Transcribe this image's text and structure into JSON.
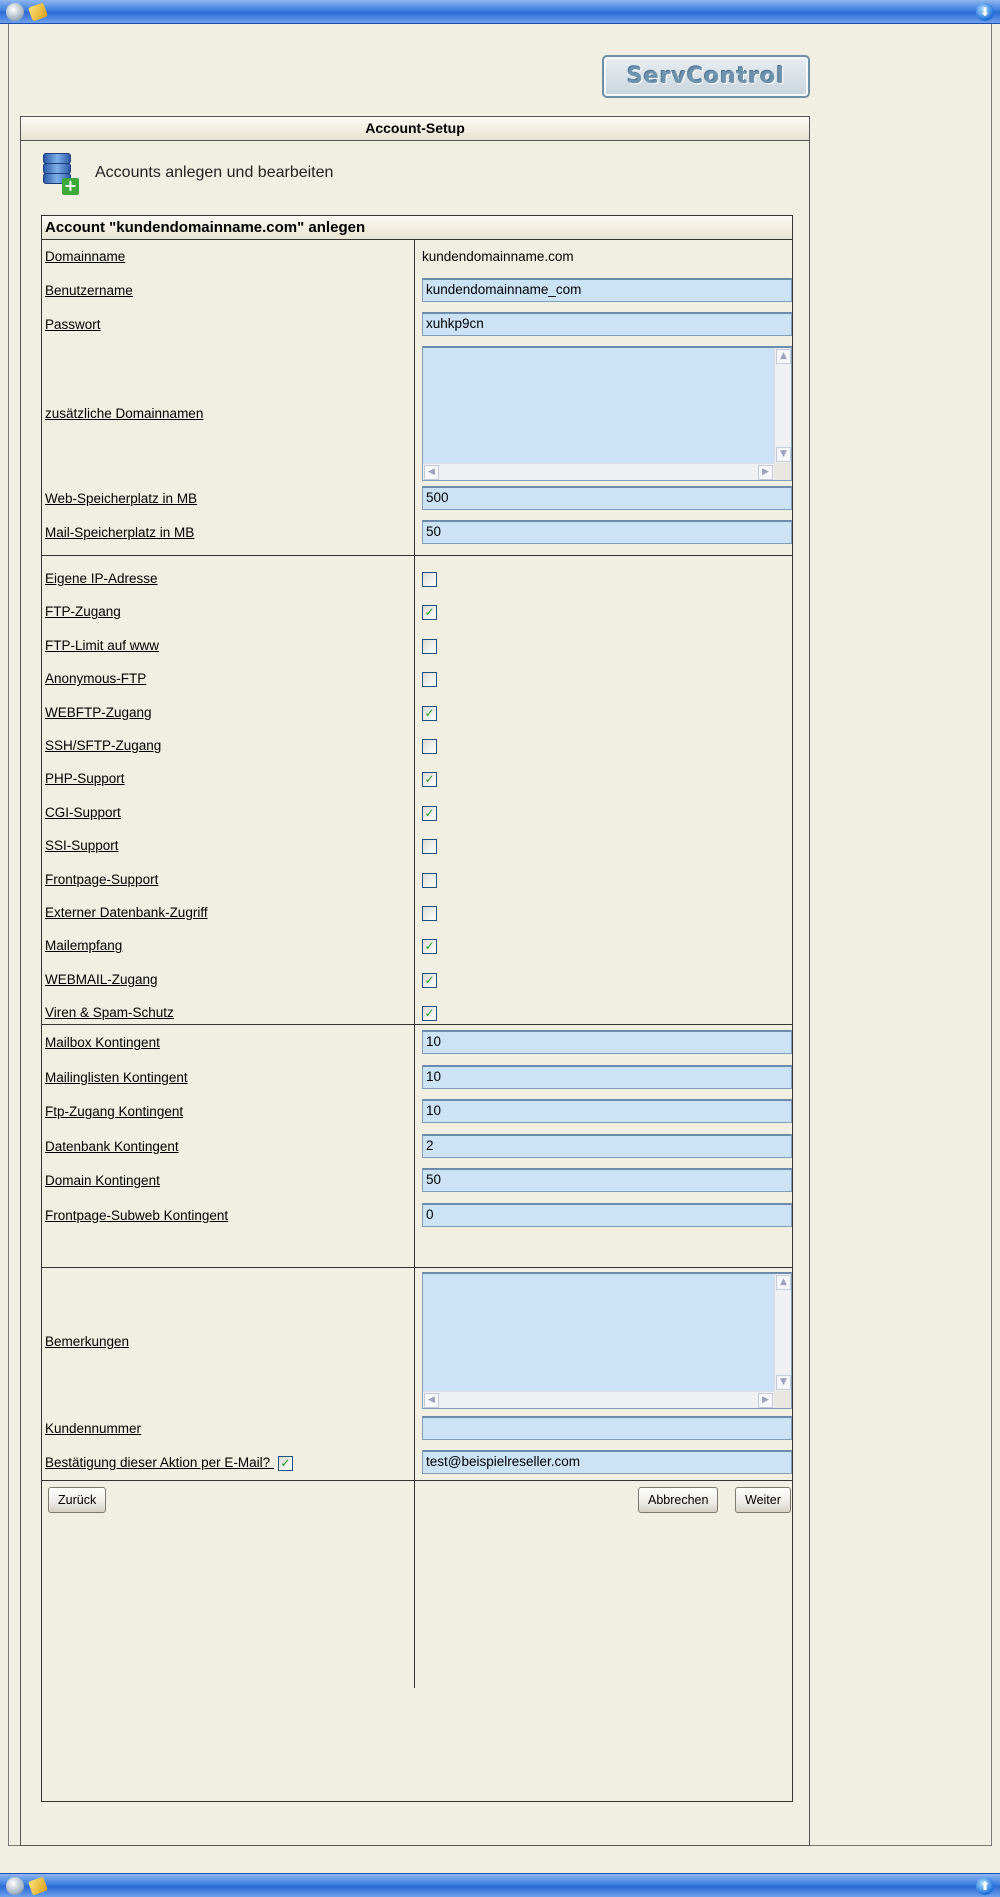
{
  "window": {
    "down_arrow": "⬇",
    "up_arrow": "⬆"
  },
  "logo": {
    "text": "ServControl"
  },
  "section": {
    "title": "Account-Setup",
    "subtitle": "Accounts anlegen und bearbeiten"
  },
  "form": {
    "header": "Account \"kundendomainname.com\" anlegen",
    "domainname": {
      "label": "Domainname",
      "value": "kundendomainname.com"
    },
    "benutzername": {
      "label": "Benutzername",
      "value": "kundendomainname_com"
    },
    "passwort": {
      "label": "Passwort",
      "value": "xuhkp9cn"
    },
    "zusaetzliche": {
      "label": "zusätzliche Domainnamen",
      "value": ""
    },
    "web_speicher": {
      "label": "Web-Speicherplatz in MB",
      "value": "500"
    },
    "mail_speicher": {
      "label": "Mail-Speicherplatz in MB",
      "value": "50"
    },
    "options": [
      {
        "label": "Eigene IP-Adresse",
        "checked": false
      },
      {
        "label": "FTP-Zugang",
        "checked": true
      },
      {
        "label": "FTP-Limit auf www",
        "checked": false
      },
      {
        "label": "Anonymous-FTP",
        "checked": false
      },
      {
        "label": "WEBFTP-Zugang",
        "checked": true
      },
      {
        "label": "SSH/SFTP-Zugang",
        "checked": false
      },
      {
        "label": "PHP-Support",
        "checked": true
      },
      {
        "label": "CGI-Support",
        "checked": true
      },
      {
        "label": "SSI-Support",
        "checked": false
      },
      {
        "label": "Frontpage-Support",
        "checked": false
      },
      {
        "label": "Externer Datenbank-Zugriff",
        "checked": false
      },
      {
        "label": "Mailempfang",
        "checked": true
      },
      {
        "label": "WEBMAIL-Zugang",
        "checked": true
      },
      {
        "label": "Viren & Spam-Schutz",
        "checked": true
      }
    ],
    "quotas": [
      {
        "label": "Mailbox Kontingent",
        "value": "10"
      },
      {
        "label": "Mailinglisten Kontingent",
        "value": "10"
      },
      {
        "label": "Ftp-Zugang Kontingent",
        "value": "10"
      },
      {
        "label": "Datenbank Kontingent",
        "value": "2"
      },
      {
        "label": "Domain Kontingent",
        "value": "50"
      },
      {
        "label": "Frontpage-Subweb Kontingent",
        "value": "0"
      }
    ],
    "bemerkungen": {
      "label": "Bemerkungen",
      "value": ""
    },
    "kundennummer": {
      "label": "Kundennummer",
      "value": ""
    },
    "bestaetigung": {
      "label": "Bestätigung dieser Aktion per E-Mail?",
      "checked": true,
      "email": "test@beispielreseller.com"
    },
    "check_glyph": "✓"
  },
  "buttons": {
    "back": "Zurück",
    "cancel": "Abbrechen",
    "next": "Weiter"
  }
}
